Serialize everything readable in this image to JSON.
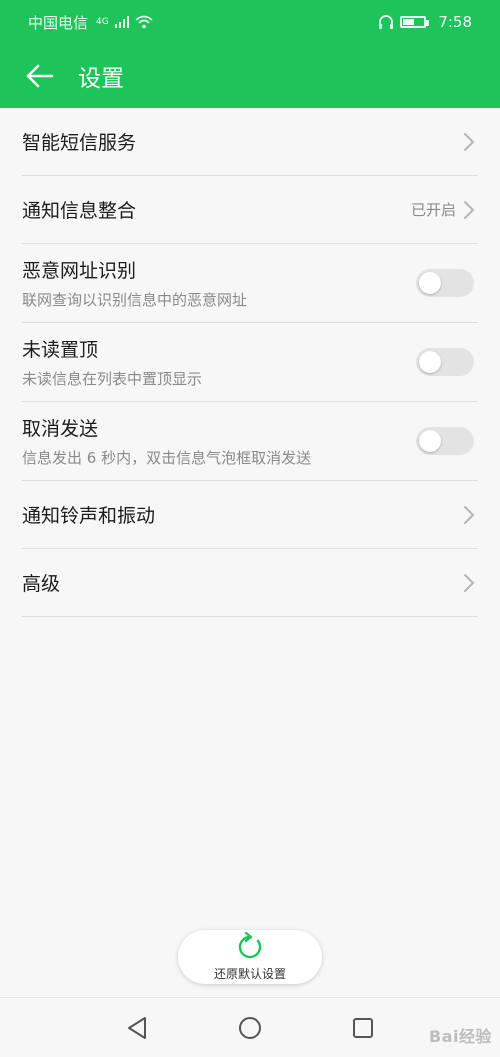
{
  "status_bar": {
    "carrier": "中国电信",
    "network": "4G",
    "time": "7:58"
  },
  "app_bar": {
    "title": "设置"
  },
  "settings": [
    {
      "title": "智能短信服务"
    },
    {
      "title": "通知信息整合",
      "value": "已开启"
    },
    {
      "title": "恶意网址识别",
      "subtitle": "联网查询以识别信息中的恶意网址",
      "toggle": false
    },
    {
      "title": "未读置顶",
      "subtitle": "未读信息在列表中置顶显示",
      "toggle": false
    },
    {
      "title": "取消发送",
      "subtitle": "信息发出 6 秒内，双击信息气泡框取消发送",
      "toggle": false
    },
    {
      "title": "通知铃声和振动"
    },
    {
      "title": "高级"
    }
  ],
  "restore_button": {
    "label": "还原默认设置"
  },
  "watermark": "Bai经验",
  "colors": {
    "accent": "#1ec35a",
    "toggle_off": "#e3e3e3",
    "secondary_text": "#8a8a8a"
  }
}
